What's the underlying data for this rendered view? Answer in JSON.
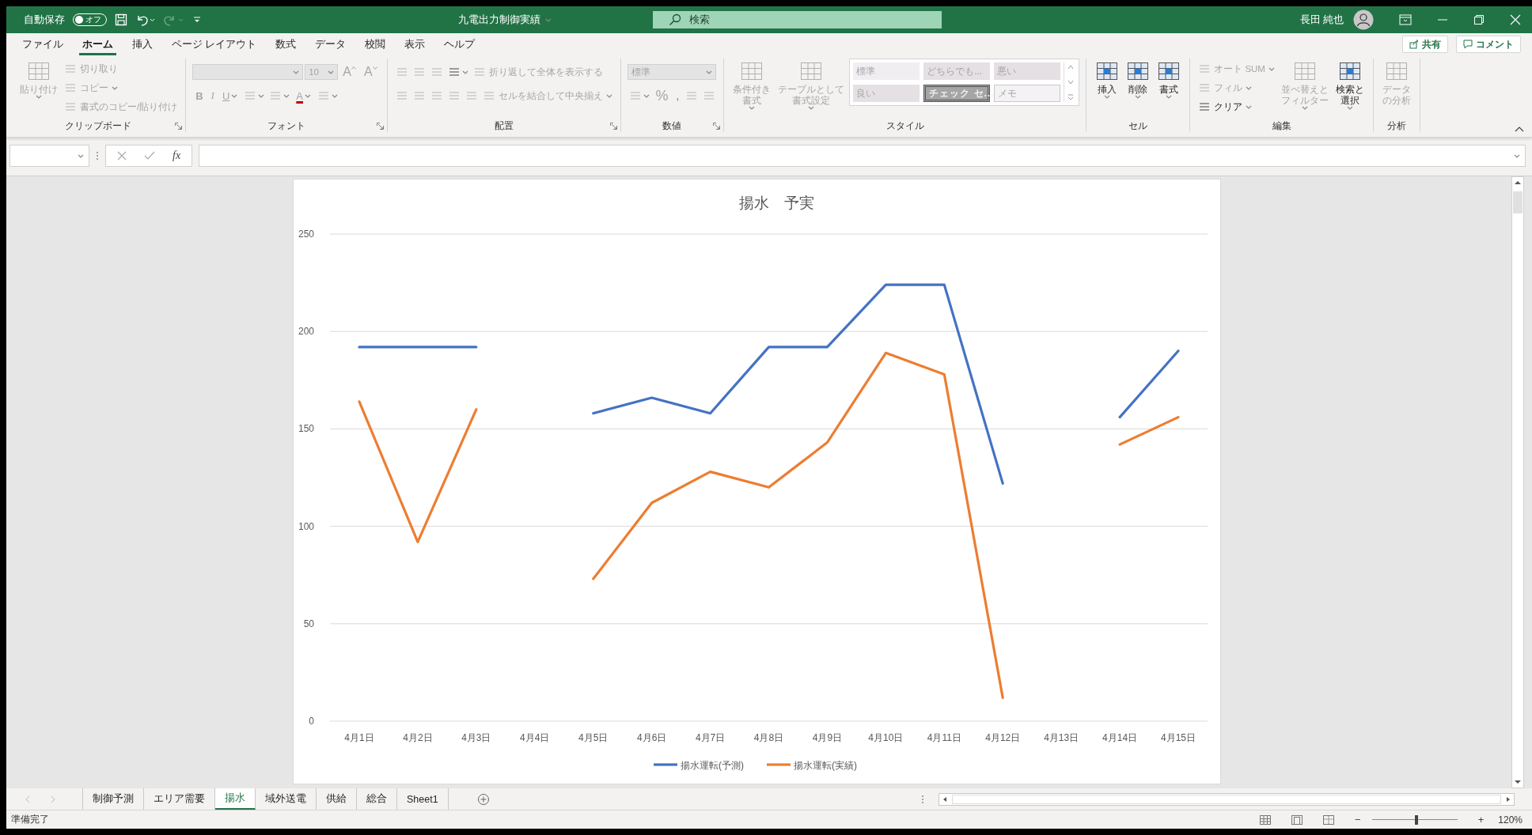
{
  "titlebar": {
    "autosave_label": "自動保存",
    "autosave": {
      "on": false,
      "label": "オフ"
    },
    "title": "九電出力制御実績",
    "search_placeholder": "検索",
    "user": "長田 純也"
  },
  "menu_tabs": [
    {
      "label": "ファイル",
      "selected": false
    },
    {
      "label": "ホーム",
      "selected": true
    },
    {
      "label": "挿入",
      "selected": false
    },
    {
      "label": "ページ レイアウト",
      "selected": false
    },
    {
      "label": "数式",
      "selected": false
    },
    {
      "label": "データ",
      "selected": false
    },
    {
      "label": "校閲",
      "selected": false
    },
    {
      "label": "表示",
      "selected": false
    },
    {
      "label": "ヘルプ",
      "selected": false
    }
  ],
  "share_button": "共有",
  "comment_button": "コメント",
  "ribbon": [
    {
      "label": "クリップボード",
      "launcher": true,
      "columns": [
        {
          "kind": "large",
          "lines": [
            "貼り付け"
          ],
          "menu": true,
          "disabled": true
        },
        {
          "kind": "stack",
          "rows": [
            [
              {
                "kind": "small",
                "label": "切り取り",
                "menu": false,
                "disabled": true
              }
            ],
            [
              {
                "kind": "small",
                "label": "コピー",
                "menu": true,
                "disabled": true
              }
            ],
            [
              {
                "kind": "small",
                "label": "書式のコピー/貼り付け",
                "menu": false,
                "disabled": true
              }
            ]
          ]
        }
      ]
    },
    {
      "label": "フォント",
      "launcher": true,
      "columns": [
        {
          "kind": "stack",
          "rows": [
            [
              {
                "kind": "combo",
                "disabled": true
              },
              {
                "kind": "minicombo",
                "value": "10",
                "disabled": true
              },
              {
                "kind": "grow",
                "label": "A",
                "disabled": true
              },
              {
                "kind": "shrink",
                "label": "A",
                "disabled": true
              }
            ],
            [
              {
                "kind": "bold",
                "label": "B",
                "menu": false,
                "disabled": true
              },
              {
                "kind": "italic",
                "label": "I",
                "menu": false,
                "disabled": true
              },
              {
                "kind": "underline",
                "label": "U",
                "menu": true,
                "disabled": true
              },
              {
                "kind": "icon",
                "menu": true,
                "disabled": true
              },
              {
                "kind": "icon",
                "menu": true,
                "disabled": true
              },
              {
                "kind": "fontcolor",
                "label": "A",
                "menu": true,
                "disabled": true
              },
              {
                "kind": "icon",
                "menu": true,
                "disabled": true
              }
            ]
          ]
        }
      ]
    },
    {
      "label": "配置",
      "launcher": true,
      "columns": [
        {
          "kind": "stack",
          "rows": [
            [
              {
                "kind": "icon",
                "menu": false,
                "disabled": true
              },
              {
                "kind": "icon",
                "menu": false,
                "disabled": true
              },
              {
                "kind": "icon",
                "menu": false,
                "disabled": true
              },
              {
                "kind": "icon",
                "menu": true,
                "disabled": false
              },
              {
                "kind": "small",
                "label": "折り返して全体を表示する",
                "menu": false,
                "disabled": true
              }
            ],
            [
              {
                "kind": "icon",
                "menu": false,
                "disabled": true
              },
              {
                "kind": "icon",
                "menu": false,
                "disabled": true
              },
              {
                "kind": "icon",
                "menu": false,
                "disabled": true
              },
              {
                "kind": "icon",
                "menu": false,
                "disabled": true
              },
              {
                "kind": "icon",
                "menu": false,
                "disabled": true
              },
              {
                "kind": "small",
                "label": "セルを結合して中央揃え",
                "menu": true,
                "disabled": true
              }
            ]
          ]
        }
      ]
    },
    {
      "label": "数値",
      "launcher": true,
      "columns": [
        {
          "kind": "stack",
          "rows": [
            [
              {
                "kind": "combo",
                "value": "標準",
                "disabled": true
              }
            ],
            [
              {
                "kind": "icon",
                "menu": true,
                "disabled": true
              },
              {
                "kind": "percent",
                "label": "%",
                "menu": false,
                "disabled": true
              },
              {
                "kind": "bold",
                "label": ",",
                "menu": false,
                "disabled": true
              },
              {
                "kind": "icon",
                "menu": false,
                "disabled": true
              },
              {
                "kind": "icon",
                "menu": false,
                "disabled": true
              }
            ]
          ]
        }
      ]
    },
    {
      "label": "スタイル",
      "launcher": false,
      "columns": [
        {
          "kind": "large",
          "lines": [
            "条件付き",
            "書式"
          ],
          "menu": true,
          "disabled": true
        },
        {
          "kind": "large",
          "lines": [
            "テーブルとして",
            "書式設定"
          ],
          "menu": true,
          "disabled": true
        },
        {
          "kind": "gallery",
          "cells": [
            "標準",
            "どちらでも...",
            "悪い",
            "良い",
            "チェック セ...",
            "メモ"
          ]
        }
      ]
    },
    {
      "label": "セル",
      "launcher": false,
      "columns": [
        {
          "kind": "large",
          "lines": [
            "挿入"
          ],
          "menu": true,
          "disabled": false
        },
        {
          "kind": "large",
          "lines": [
            "削除"
          ],
          "menu": true,
          "disabled": false
        },
        {
          "kind": "large",
          "lines": [
            "書式"
          ],
          "menu": true,
          "disabled": false
        }
      ]
    },
    {
      "label": "編集",
      "launcher": false,
      "columns": [
        {
          "kind": "stack",
          "rows": [
            [
              {
                "kind": "small",
                "label": "オート SUM",
                "menu": true,
                "disabled": true
              }
            ],
            [
              {
                "kind": "small",
                "label": "フィル",
                "menu": true,
                "disabled": true
              }
            ],
            [
              {
                "kind": "small",
                "label": "クリア",
                "menu": true,
                "disabled": false
              }
            ]
          ]
        },
        {
          "kind": "large",
          "lines": [
            "並べ替えと",
            "フィルター"
          ],
          "menu": true,
          "disabled": true
        },
        {
          "kind": "large",
          "lines": [
            "検索と",
            "選択"
          ],
          "menu": true,
          "disabled": false
        }
      ]
    },
    {
      "label": "分析",
      "launcher": false,
      "columns": [
        {
          "kind": "large",
          "lines": [
            "データ",
            "の分析"
          ],
          "menu": false,
          "disabled": true
        }
      ]
    }
  ],
  "formula_bar": {
    "function_label": "fx"
  },
  "chart": {
    "chart_data": {
      "type": "line",
      "title": "揚水　予実",
      "categories": [
        "4月1日",
        "4月2日",
        "4月3日",
        "4月4日",
        "4月5日",
        "4月6日",
        "4月7日",
        "4月8日",
        "4月9日",
        "4月10日",
        "4月11日",
        "4月12日",
        "4月13日",
        "4月14日",
        "4月15日"
      ],
      "series": [
        {
          "name": "揚水運転(予測)",
          "color": "#4472c4",
          "values": [
            192,
            192,
            192,
            null,
            158,
            166,
            158,
            192,
            192,
            224,
            224,
            122,
            null,
            156,
            190
          ]
        },
        {
          "name": "揚水運転(実績)",
          "color": "#ed7d31",
          "values": [
            164,
            92,
            160,
            null,
            73,
            112,
            128,
            120,
            143,
            189,
            178,
            12,
            null,
            142,
            156
          ]
        }
      ],
      "ylim": [
        0,
        250
      ],
      "yticks": [
        0,
        50,
        100,
        150,
        200,
        250
      ],
      "grid": true,
      "legend": true
    }
  },
  "sheet_tabs": [
    {
      "label": "制御予測",
      "selected": false
    },
    {
      "label": "エリア需要",
      "selected": false
    },
    {
      "label": "揚水",
      "selected": true
    },
    {
      "label": "域外送電",
      "selected": false
    },
    {
      "label": "供給",
      "selected": false
    },
    {
      "label": "総合",
      "selected": false
    },
    {
      "label": "Sheet1",
      "selected": false
    }
  ],
  "status_bar": {
    "text": "準備完了",
    "zoom_out": "−",
    "zoom_in": "+",
    "zoom": {
      "level": 0.52,
      "label": "120%"
    }
  }
}
